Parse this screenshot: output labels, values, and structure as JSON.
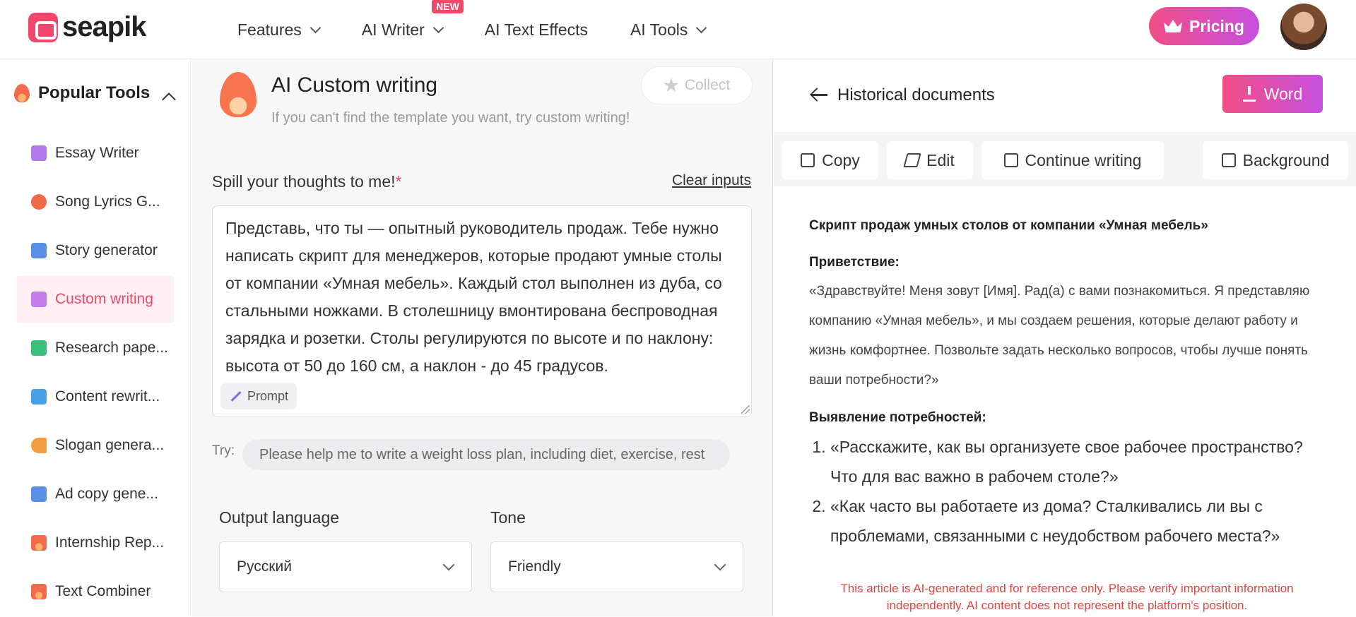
{
  "brand": {
    "name": "seapik"
  },
  "nav": {
    "items": [
      {
        "label": "Features",
        "has_dropdown": true
      },
      {
        "label": "AI Writer",
        "has_dropdown": true,
        "badge": "NEW"
      },
      {
        "label": "AI Text Effects",
        "has_dropdown": false
      },
      {
        "label": "AI Tools",
        "has_dropdown": true
      }
    ],
    "pricing_label": "Pricing"
  },
  "sidebar": {
    "heading": "Popular Tools",
    "items": [
      {
        "label": "Essay Writer",
        "icon": "essay-icon",
        "color": "#b07be8"
      },
      {
        "label": "Song Lyrics G...",
        "icon": "music-icon",
        "color": "#f06a4a"
      },
      {
        "label": "Story generator",
        "icon": "story-icon",
        "color": "#5b8fe6"
      },
      {
        "label": "Custom writing",
        "icon": "custom-writing-icon",
        "color": "#c47be8",
        "active": true
      },
      {
        "label": "Research pape...",
        "icon": "research-icon",
        "color": "#38c07a"
      },
      {
        "label": "Content rewrit...",
        "icon": "rewrite-icon",
        "color": "#4aa0e8"
      },
      {
        "label": "Slogan genera...",
        "icon": "megaphone-icon",
        "color": "#f39c3d"
      },
      {
        "label": "Ad copy gene...",
        "icon": "ad-icon",
        "color": "#5b8fe6"
      },
      {
        "label": "Internship Rep...",
        "icon": "flame-icon",
        "color": "#f36b4a"
      },
      {
        "label": "Text Combiner",
        "icon": "flame-icon",
        "color": "#f36b4a"
      }
    ]
  },
  "tool": {
    "title": "AI Custom writing",
    "subtitle": "If you can't find the template you want, try custom writing!",
    "collect_label": "Collect",
    "prompt_label": "Spill your thoughts to me!",
    "required_mark": "*",
    "clear_label": "Clear inputs",
    "prompt_text": "Представь, что ты — опытный руководитель продаж. Тебе нужно написать скрипт для менеджеров, которые продают умные столы от компании «Умная мебель». Каждый стол выполнен из дуба, со стальными ножками. В столешницу вмонтирована беспроводная зарядка и розетки. Столы регулируются по высоте и по наклону: высота от 50 до 160 см, а наклон - до 45 градусов.",
    "prompt_chip_label": "Prompt",
    "try_label": "Try:",
    "try_suggestion": "Please help me to write a weight loss plan, including diet, exercise, rest",
    "output_language_label": "Output language",
    "output_language_value": "Русский",
    "tone_label": "Tone",
    "tone_value": "Friendly"
  },
  "history": {
    "title": "Historical documents",
    "word_label": "Word",
    "toolbar": {
      "copy": "Copy",
      "edit": "Edit",
      "continue": "Continue writing",
      "background": "Background"
    },
    "doc": {
      "title": "Скрипт продаж умных столов от компании «Умная мебель»",
      "greeting_heading": "Приветствие:",
      "greeting_text": "«Здравствуйте! Меня зовут [Имя]. Рад(а) с вами познакомиться. Я представляю компанию «Умная мебель», и мы создаем решения, которые делают работу и жизнь комфортнее. Позвольте задать несколько вопросов, чтобы лучше понять ваши потребности?»",
      "needs_heading": "Выявление потребностей:",
      "questions": [
        "«Расскажите, как вы организуете свое рабочее пространство? Что для вас важно в рабочем столе?»",
        "«Как часто вы работаете из дома? Сталкивались ли вы с проблемами, связанными с неудобством рабочего места?»"
      ]
    },
    "disclaimer": "This article is AI-generated and for reference only. Please verify important information independently. AI content does not represent the platform's position."
  },
  "colors": {
    "accent": "#f0476a",
    "gradient_start": "#f24d85",
    "gradient_end": "#c64fe0",
    "disclaimer": "#e0443e"
  }
}
